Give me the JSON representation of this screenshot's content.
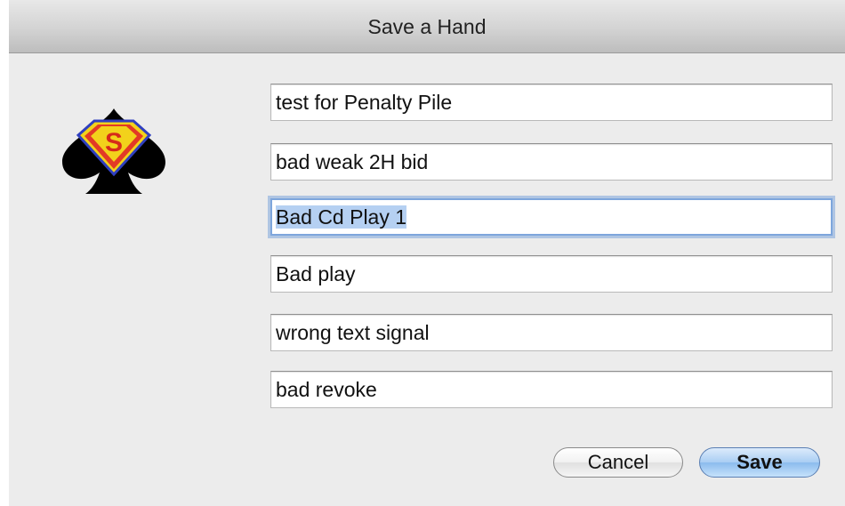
{
  "window": {
    "title": "Save a Hand"
  },
  "logo": {
    "icon": "superman-spade-logo-icon",
    "emblem_letter": "S"
  },
  "fields": [
    {
      "value": "test for Penalty Pile"
    },
    {
      "value": "bad weak 2H bid"
    },
    {
      "value": "Bad Cd Play 1",
      "focused": true,
      "selected": true
    },
    {
      "value": "Bad play"
    },
    {
      "value": "wrong text signal"
    },
    {
      "value": "bad revoke"
    }
  ],
  "buttons": {
    "cancel_label": "Cancel",
    "save_label": "Save"
  },
  "colors": {
    "focus_ring": "#7ea6dc",
    "selection": "#b5d0f2",
    "default_button": "#8bbbed"
  }
}
